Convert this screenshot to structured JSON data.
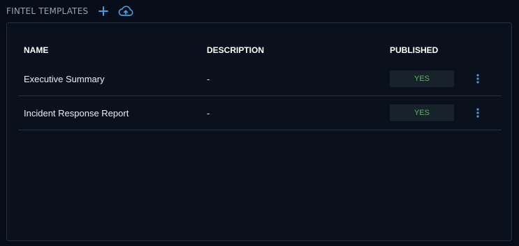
{
  "header": {
    "title": "FINTEL TEMPLATES",
    "add_icon": "plus-icon",
    "upload_icon": "cloud-upload-icon"
  },
  "table": {
    "columns": [
      "NAME",
      "DESCRIPTION",
      "PUBLISHED"
    ],
    "rows": [
      {
        "name": "Executive Summary",
        "description": "-",
        "published": "YES"
      },
      {
        "name": "Incident Response Report",
        "description": "-",
        "published": "YES"
      }
    ],
    "row_menu_icon": "kebab-menu-icon"
  },
  "colors": {
    "background": "#070d18",
    "panel": "#0a111d",
    "border": "#243043",
    "accent": "#3ea0e6",
    "published_text": "#56b85d",
    "published_bg": "#17222b"
  }
}
